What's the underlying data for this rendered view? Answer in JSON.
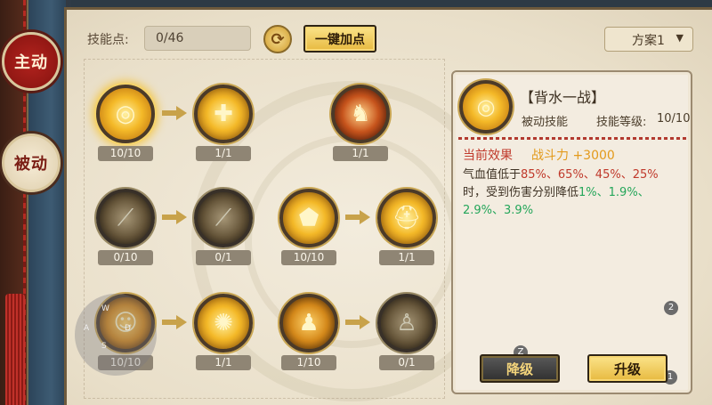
{
  "side_tabs": [
    {
      "label": "主动",
      "active": true
    },
    {
      "label": "被动",
      "active": false
    }
  ],
  "header": {
    "skill_points_label": "技能点:",
    "skill_points_value": "0/46",
    "auto_add_label": "一键加点",
    "scheme_label": "方案1"
  },
  "skills": [
    {
      "level": "10/10",
      "icon": "golden-swirl-icon",
      "selected": true
    },
    {
      "level": "1/1",
      "icon": "shield-plus-icon"
    },
    {
      "level": "1/1",
      "icon": "dragon-warrior-icon"
    },
    {
      "level": "0/10",
      "icon": "blade-icon"
    },
    {
      "level": "0/1",
      "icon": "blade-light-icon"
    },
    {
      "level": "10/10",
      "icon": "golden-shield-icon"
    },
    {
      "level": "1/1",
      "icon": "helmet-icon"
    },
    {
      "level": "10/10",
      "icon": "mask-icon"
    },
    {
      "level": "1/1",
      "icon": "radiant-figure-icon"
    },
    {
      "level": "1/10",
      "icon": "figure-icon"
    },
    {
      "level": "0/1",
      "icon": "raised-arms-figure-icon"
    }
  ],
  "info": {
    "name": "【背水一战】",
    "type": "被动技能",
    "level_label": "技能等级:",
    "level_value": "10/10",
    "effect_title": "当前效果",
    "effect_value": "战斗力 +3000",
    "desc_prefix": "气血值低于",
    "desc_thresholds": "85%、65%、45%、25%",
    "desc_middle": "时，受到伤害分别降低",
    "desc_reductions": "1%、1.9%、2.9%、3.9%"
  },
  "buttons": {
    "downgrade": "降级",
    "upgrade": "升级"
  },
  "overlay": {
    "joystick_keys": [
      "W",
      "A",
      "S",
      "D"
    ],
    "hotkey_z": "Z",
    "badge_1": "1",
    "badge_2": "2"
  }
}
